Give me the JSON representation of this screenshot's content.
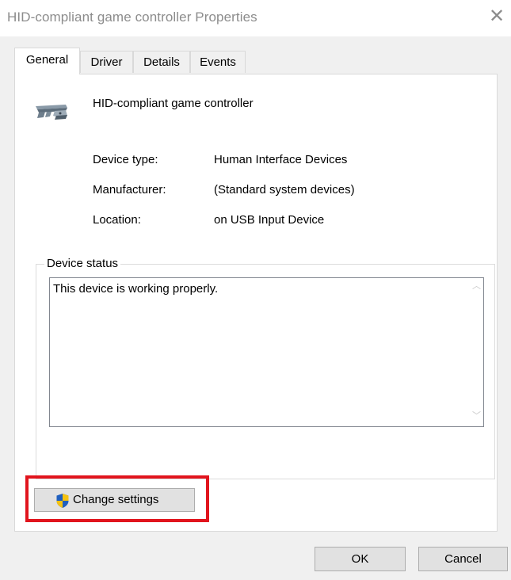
{
  "window": {
    "title": "HID-compliant game controller Properties",
    "close_glyph": "✕"
  },
  "tabs": [
    {
      "label": "General",
      "active": true
    },
    {
      "label": "Driver",
      "active": false
    },
    {
      "label": "Details",
      "active": false
    },
    {
      "label": "Events",
      "active": false
    }
  ],
  "device": {
    "name": "HID-compliant game controller",
    "icon": "game-controller-icon",
    "properties": [
      {
        "label": "Device type:",
        "value": "Human Interface Devices"
      },
      {
        "label": "Manufacturer:",
        "value": "(Standard system devices)"
      },
      {
        "label": "Location:",
        "value": "on USB Input Device"
      }
    ]
  },
  "status": {
    "legend": "Device status",
    "text": "This device is working properly."
  },
  "buttons": {
    "change_settings": "Change settings",
    "ok": "OK",
    "cancel": "Cancel"
  },
  "colors": {
    "highlight": "#e1141d",
    "shield_blue": "#1f5fbf",
    "shield_yellow": "#f5c211"
  }
}
